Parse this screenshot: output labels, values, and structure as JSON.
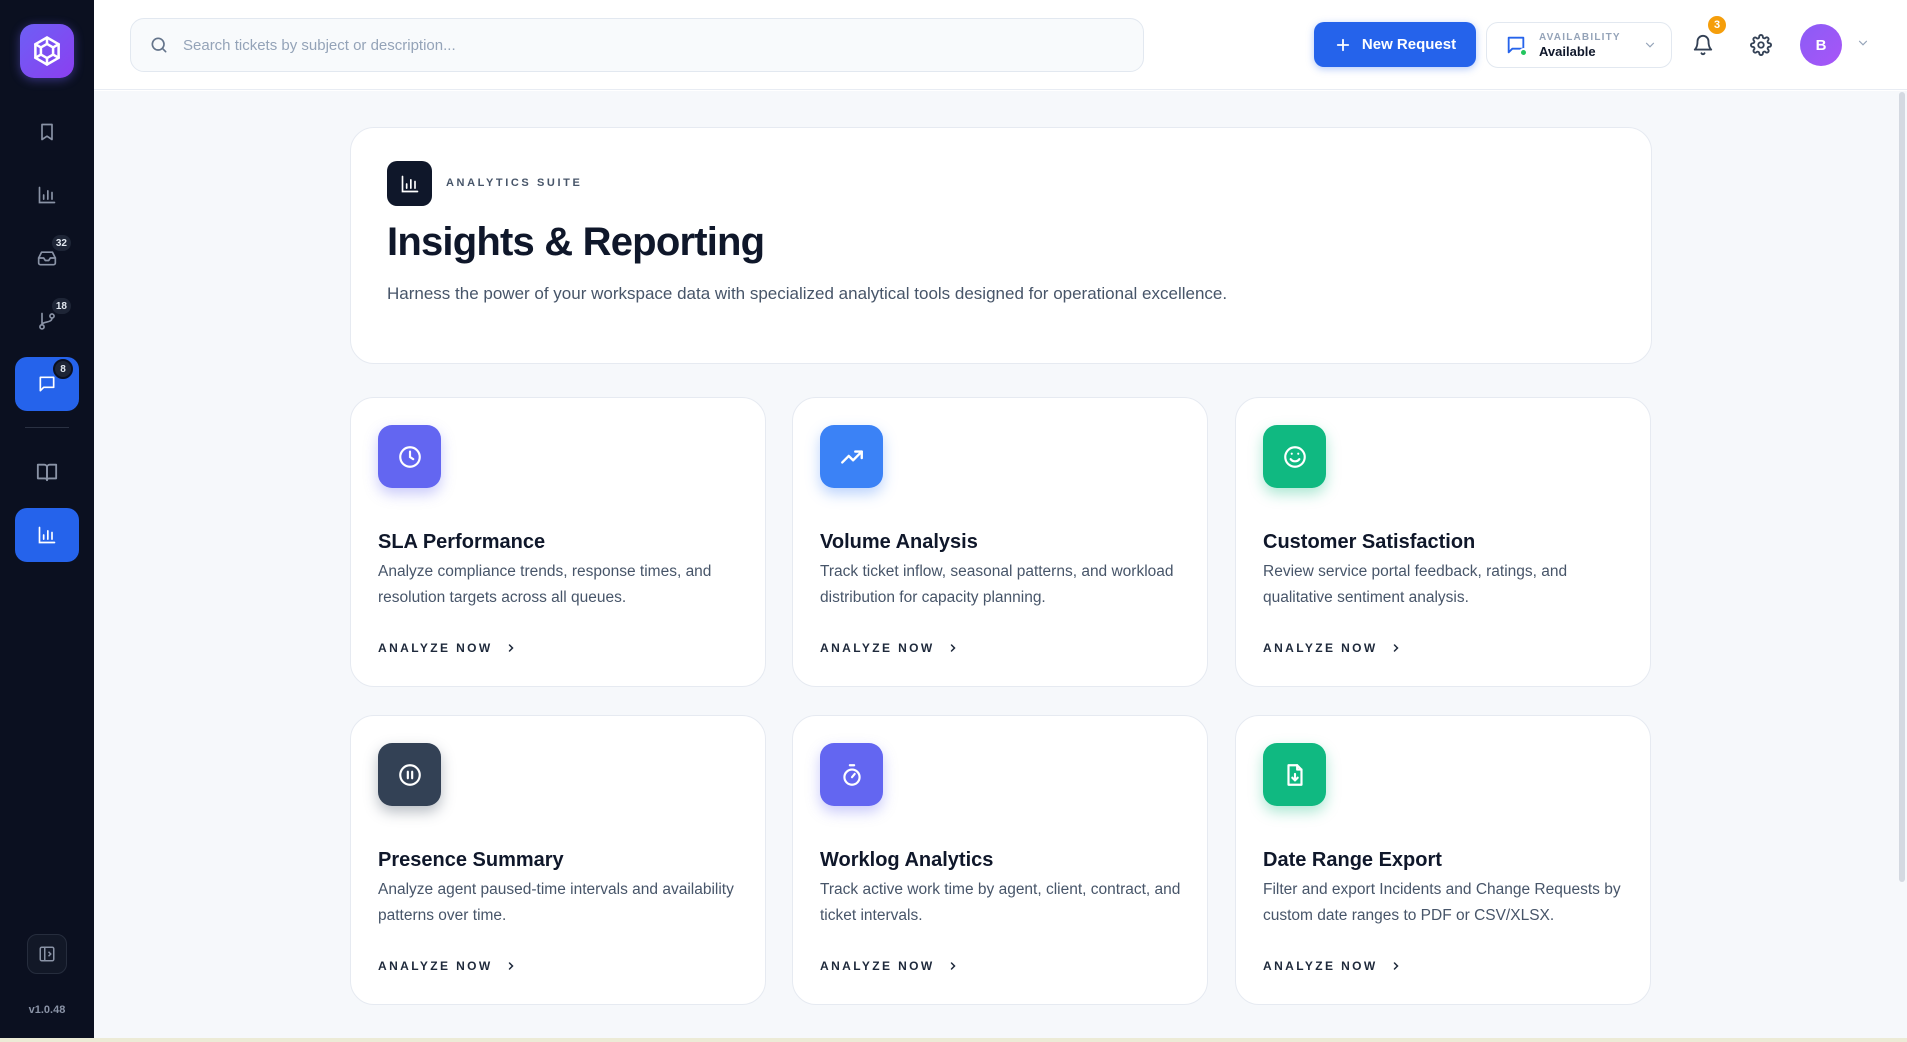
{
  "app": {
    "version": "v1.0.48",
    "accent_color": "#2563eb",
    "sidebar_bg": "#0b1020"
  },
  "sidebar": {
    "items": [
      {
        "name": "bookmark",
        "icon": "bookmark-icon",
        "badge": null,
        "active": false
      },
      {
        "name": "reports",
        "icon": "bar-chart-icon",
        "badge": null,
        "active": false
      },
      {
        "name": "inbox",
        "icon": "inbox-icon",
        "badge": "32",
        "active": false
      },
      {
        "name": "changes",
        "icon": "git-branch-icon",
        "badge": "18",
        "active": false
      },
      {
        "name": "chat",
        "icon": "chat-icon",
        "badge": "8",
        "active": true
      },
      {
        "name": "knowledge",
        "icon": "book-icon",
        "badge": null,
        "active": false
      },
      {
        "name": "analytics",
        "icon": "bar-chart-icon",
        "badge": null,
        "active": true
      }
    ]
  },
  "header": {
    "search_placeholder": "Search tickets by subject or description...",
    "new_request_label": "New Request",
    "availability_caption": "AVAILABILITY",
    "availability_value": "Available",
    "notification_count": "3",
    "avatar_initial": "B"
  },
  "hero": {
    "eyebrow": "ANALYTICS SUITE",
    "title": "Insights & Reporting",
    "description": "Harness the power of your workspace data with specialized analytical tools designed for operational excellence."
  },
  "cards": [
    {
      "title": "SLA Performance",
      "description": "Analyze compliance trends, response times, and resolution targets across all queues.",
      "link": "ANALYZE NOW",
      "icon": "clock-icon",
      "color": "#6366f1"
    },
    {
      "title": "Volume Analysis",
      "description": "Track ticket inflow, seasonal patterns, and workload distribution for capacity planning.",
      "link": "ANALYZE NOW",
      "icon": "trending-up-icon",
      "color": "#3b82f6"
    },
    {
      "title": "Customer Satisfaction",
      "description": "Review service portal feedback, ratings, and qualitative sentiment analysis.",
      "link": "ANALYZE NOW",
      "icon": "smile-icon",
      "color": "#10b981"
    },
    {
      "title": "Presence Summary",
      "description": "Analyze agent paused-time intervals and availability patterns over time.",
      "link": "ANALYZE NOW",
      "icon": "pause-circle-icon",
      "color": "#334155"
    },
    {
      "title": "Worklog Analytics",
      "description": "Track active work time by agent, client, contract, and ticket intervals.",
      "link": "ANALYZE NOW",
      "icon": "stopwatch-icon",
      "color": "#6366f1"
    },
    {
      "title": "Date Range Export",
      "description": "Filter and export Incidents and Change Requests by custom date ranges to PDF or CSV/XLSX.",
      "link": "ANALYZE NOW",
      "icon": "file-download-icon",
      "color": "#10b981"
    }
  ]
}
